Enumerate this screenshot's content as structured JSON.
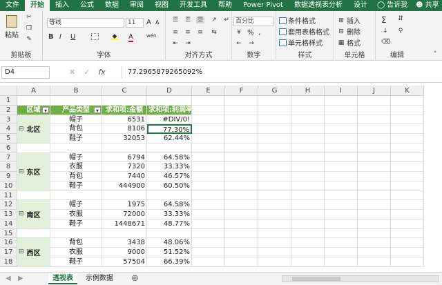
{
  "tabs": [
    "文件",
    "开始",
    "插入",
    "公式",
    "数据",
    "审阅",
    "视图",
    "开发工具",
    "帮助",
    "Power Pivot",
    "数据透视表分析",
    "设计"
  ],
  "active_tab": "开始",
  "tell_me": "告诉我",
  "share": "共享",
  "ribbon": {
    "clipboard": {
      "paste": "粘贴",
      "label": "剪贴板"
    },
    "font": {
      "name": "等线",
      "size": "11",
      "bold": "B",
      "italic": "I",
      "underline": "U",
      "grow": "A",
      "shrink": "A",
      "color_a": "A",
      "wen": "wén",
      "label": "字体"
    },
    "align": {
      "label": "对齐方式"
    },
    "number": {
      "format": "百分比",
      "pct": "%",
      "comma": ",",
      "label": "数字"
    },
    "styles": {
      "cond": "条件格式",
      "table": "套用表格格式",
      "cell": "单元格样式",
      "label": "样式"
    },
    "cells": {
      "insert": "插入",
      "delete": "删除",
      "format": "格式",
      "label": "单元格"
    },
    "editing": {
      "sum": "Σ",
      "label": "编辑"
    }
  },
  "name_box": "D4",
  "formula": "77.2965879265092%",
  "grid": {
    "columns": [
      "A",
      "B",
      "C",
      "D",
      "E",
      "F",
      "G",
      "H",
      "I",
      "J",
      "K"
    ],
    "rows": [
      "1",
      "2",
      "3",
      "4",
      "5",
      "6",
      "7",
      "8",
      "9",
      "10",
      "11",
      "12",
      "13",
      "14",
      "15",
      "16",
      "17",
      "18"
    ],
    "headers": [
      "区域",
      "产品类型",
      "求和项:金额",
      "求和项:利润率"
    ],
    "region_cells": [
      {
        "region": "北区"
      },
      {
        "region": "东区"
      },
      {
        "region": "南区"
      },
      {
        "region": "西区"
      }
    ],
    "data_rows": [
      {
        "product": "帽子",
        "amount": "6531",
        "margin": "#DIV/0!"
      },
      {
        "product": "背包",
        "amount": "8106",
        "margin": "77.30%"
      },
      {
        "product": "鞋子",
        "amount": "32053",
        "margin": "62.44%"
      },
      {
        "product": "帽子",
        "amount": "6794",
        "margin": "64.58%"
      },
      {
        "product": "衣服",
        "amount": "7320",
        "margin": "33.33%"
      },
      {
        "product": "背包",
        "amount": "7440",
        "margin": "46.57%"
      },
      {
        "product": "鞋子",
        "amount": "444900",
        "margin": "60.50%"
      },
      {
        "product": "帽子",
        "amount": "1975",
        "margin": "64.58%"
      },
      {
        "product": "衣服",
        "amount": "72000",
        "margin": "33.33%"
      },
      {
        "product": "鞋子",
        "amount": "1448671",
        "margin": "48.77%"
      },
      {
        "product": "背包",
        "amount": "3438",
        "margin": "48.06%"
      },
      {
        "product": "衣服",
        "amount": "9000",
        "margin": "51.52%"
      },
      {
        "product": "鞋子",
        "amount": "57504",
        "margin": "66.39%"
      }
    ]
  },
  "sheets": [
    "透视表",
    "示例数据"
  ],
  "active_sheet": "透视表",
  "colors": {
    "accent": "#217346",
    "pivot_header": "#70ad47",
    "pivot_row": "#e2efda"
  }
}
